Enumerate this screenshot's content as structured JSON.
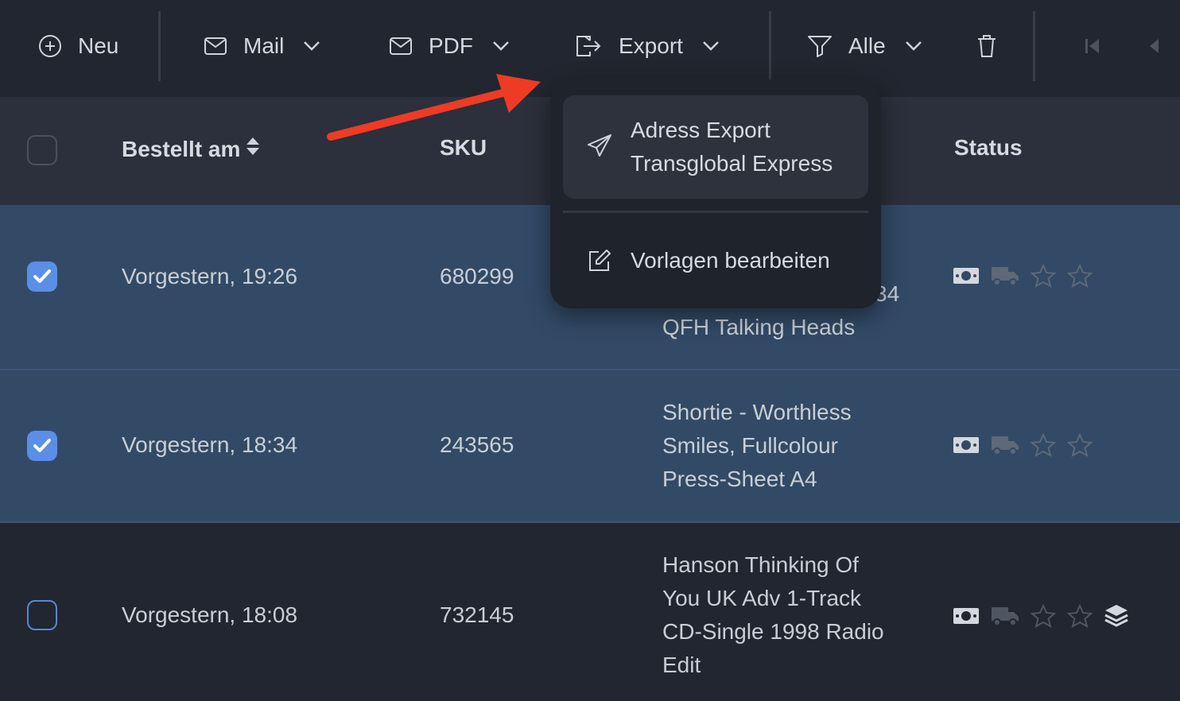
{
  "toolbar": {
    "new_label": "Neu",
    "mail_label": "Mail",
    "pdf_label": "PDF",
    "export_label": "Export",
    "filter_label": "Alle"
  },
  "table": {
    "columns": [
      "Bestellt am",
      "SKU",
      "Status"
    ],
    "rows": [
      {
        "date": "Vorgestern, 19:26",
        "sku": "680299",
        "product_partial": "34",
        "product_lines": [
          "QFH Talking Heads"
        ],
        "selected": true
      },
      {
        "date": "Vorgestern, 18:34",
        "sku": "243565",
        "product_lines": [
          "Shortie - Worthless",
          "Smiles, Fullcolour",
          "Press-Sheet A4"
        ],
        "selected": true
      },
      {
        "date": "Vorgestern, 18:08",
        "sku": "732145",
        "product_lines": [
          "Hanson Thinking Of",
          "You UK Adv 1-Track",
          "CD-Single 1998 Radio",
          "Edit"
        ],
        "selected": false
      }
    ]
  },
  "export_menu": {
    "items": [
      {
        "line1": "Adress Export",
        "line2": "Transglobal Express"
      },
      {
        "line1": "Vorlagen bearbeiten"
      }
    ]
  },
  "icons": {
    "new": "plus-circle-icon",
    "mail": "envelope-icon",
    "pdf": "envelope-icon",
    "export": "file-export-icon",
    "filter": "funnel-icon",
    "delete": "trash-icon",
    "first_page": "first-page-icon",
    "prev_page": "prev-page-icon",
    "status": [
      "money-icon",
      "truck-icon",
      "star-icon",
      "star-icon",
      "layers-icon"
    ]
  },
  "colors": {
    "accent": "#5b8ee6",
    "selected_row": "#324a66",
    "arrow": "#ee3b24"
  }
}
